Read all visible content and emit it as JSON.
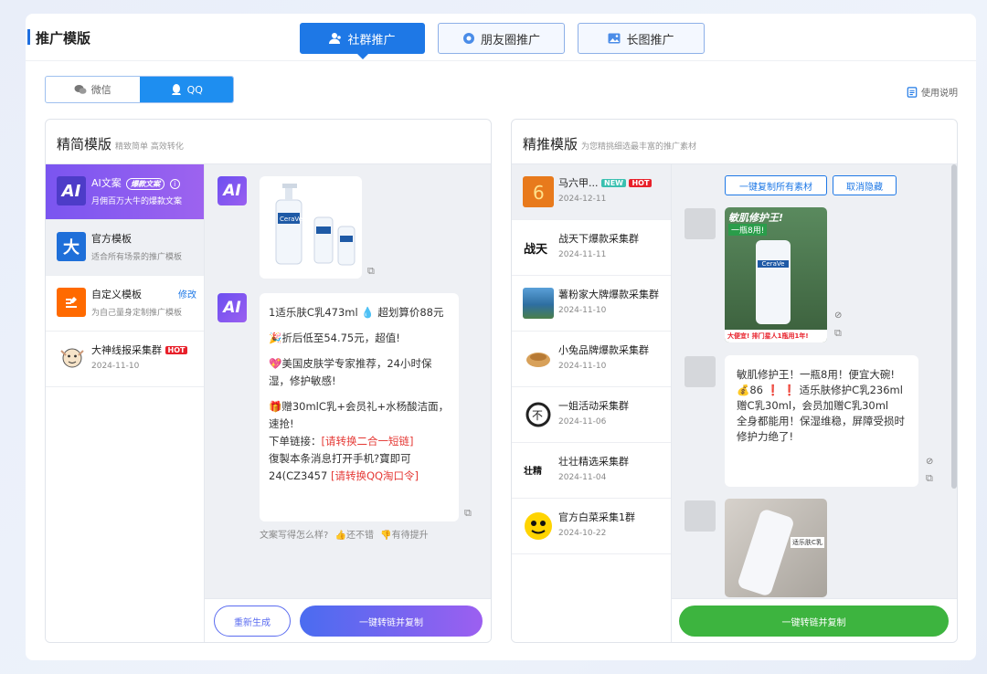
{
  "header": {
    "title": "推广模版",
    "tabs": [
      {
        "label": "社群推广"
      },
      {
        "label": "朋友圈推广"
      },
      {
        "label": "长图推广"
      }
    ]
  },
  "platform_tabs": [
    {
      "label": "微信"
    },
    {
      "label": "QQ"
    }
  ],
  "help_label": "使用说明",
  "left_panel": {
    "title": "精简模版",
    "subtitle": "精致简单 高效转化",
    "templates": [
      {
        "name": "AI文案",
        "tag": "爆款文案",
        "desc": "月佣百万大牛的爆款文案",
        "icon": "AI"
      },
      {
        "name": "官方模板",
        "desc": "适合所有场景的推广模板",
        "icon": "大"
      },
      {
        "name": "自定义模板",
        "edit": "修改",
        "desc": "为自己量身定制推广模板"
      },
      {
        "name": "大神线报采集群",
        "hot": "HOT",
        "desc": "2024-11-10"
      }
    ],
    "ai_label": "AI",
    "message": {
      "line1": "1适乐肤C乳473ml 💧 超划算价88元",
      "line2": "🎉折后低至54.75元，超值!",
      "line3": "💖美国皮肤学专家推荐，24小时保湿，修护敏感!",
      "line4": "🎁赠30mlC乳+会员礼+水杨酸洁面，速抢!",
      "line5_prefix": "下单链接：",
      "line5_link": "[请转换二合一短链]",
      "line6": "復製本条消息打开手机?寶即可24(CZ3457 ",
      "line6_link": "[请转换QQ淘口令]"
    },
    "feedback": {
      "q": "文案写得怎么样?",
      "good": "还不错",
      "bad": "有待提升"
    },
    "regen_label": "重新生成",
    "convert_label": "一键转链并复制"
  },
  "right_panel": {
    "title": "精推模版",
    "subtitle": "为您精挑细选最丰富的推广素材",
    "groups": [
      {
        "name": "马六甲...",
        "new": "NEW",
        "hot": "HOT",
        "date": "2024-12-11"
      },
      {
        "name": "战天下爆款采集群",
        "date": "2024-11-11"
      },
      {
        "name": "薯粉家大牌爆款采集群",
        "date": "2024-11-10"
      },
      {
        "name": "小兔品牌爆款采集群",
        "date": "2024-11-10"
      },
      {
        "name": "一姐活动采集群",
        "date": "2024-11-06"
      },
      {
        "name": "壮壮精选采集群",
        "date": "2024-11-04"
      },
      {
        "name": "官方白菜采集1群",
        "date": "2024-10-22"
      }
    ],
    "copy_all_label": "一键复制所有素材",
    "cancel_hide_label": "取消隐藏",
    "poster": {
      "title": "敏肌修护王!",
      "sub": "一瓶8用!",
      "bottom": "大便宜! 排门星人1瓶用1年!",
      "brand": "CeraVe"
    },
    "msg": {
      "l1": "敏肌修护王！一瓶8用！便宜大碗!",
      "l2": "86 ❗ ❗ 适乐肤修护C乳236ml",
      "l3": "赠C乳30ml，会员加赠C乳30ml",
      "l4": "全身都能用！保湿维稳，屏障受损时修护力绝了!"
    },
    "photo_label": "适乐肤C乳",
    "convert_label": "一键转链并复制"
  },
  "colors": {
    "accent": "#1e78e6",
    "purple": "#7a55f0",
    "green": "#3db43f",
    "hot": "#e8202a"
  }
}
